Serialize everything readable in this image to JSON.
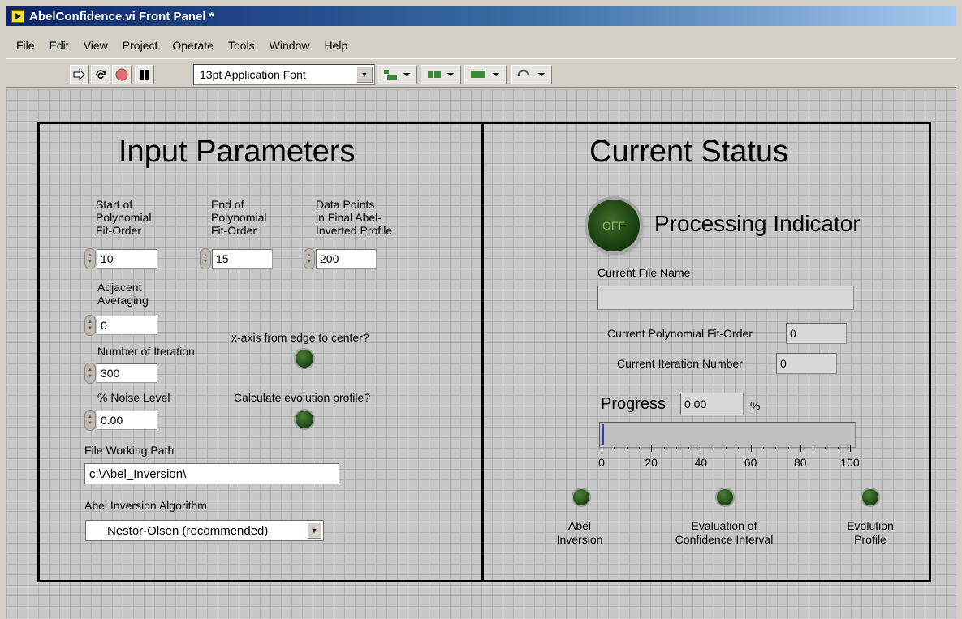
{
  "window": {
    "title": "AbelConfidence.vi Front Panel *"
  },
  "menu": [
    "File",
    "Edit",
    "View",
    "Project",
    "Operate",
    "Tools",
    "Window",
    "Help"
  ],
  "toolbar": {
    "font": "13pt Application Font"
  },
  "input": {
    "title": "Input Parameters",
    "start_label": "Start of\nPolynomial\nFit-Order",
    "start_value": "10",
    "end_label": "End of\nPolynomial\nFit-Order",
    "end_value": "15",
    "points_label": "Data Points\nin Final Abel-\nInverted Profile",
    "points_value": "200",
    "adj_label": "Adjacent\nAveraging",
    "adj_value": "0",
    "iter_label": "Number of Iteration",
    "iter_value": "300",
    "noise_label": "% Noise Level",
    "noise_value": "0.00",
    "xaxis_label": "x-axis from edge to center?",
    "evol_label": "Calculate evolution profile?",
    "path_label": "File Working Path",
    "path_value": "c:\\Abel_Inversion\\",
    "algo_label": "Abel Inversion Algorithm",
    "algo_value": "Nestor-Olsen (recommended)"
  },
  "status": {
    "title": "Current Status",
    "processing_label": "Processing Indicator",
    "led_text": "OFF",
    "file_label": "Current File Name",
    "file_value": "",
    "fitorder_label": "Current Polynomial Fit-Order",
    "fitorder_value": "0",
    "iter_label": "Current Iteration Number",
    "iter_value": "0",
    "progress_label": "Progress",
    "progress_value": "0.00",
    "progress_unit": "%",
    "progress_ticks": [
      "0",
      "20",
      "40",
      "60",
      "80",
      "100"
    ],
    "abel_label": "Abel\nInversion",
    "conf_label": "Evaluation of\nConfidence Interval",
    "evol_label": "Evolution\nProfile"
  }
}
